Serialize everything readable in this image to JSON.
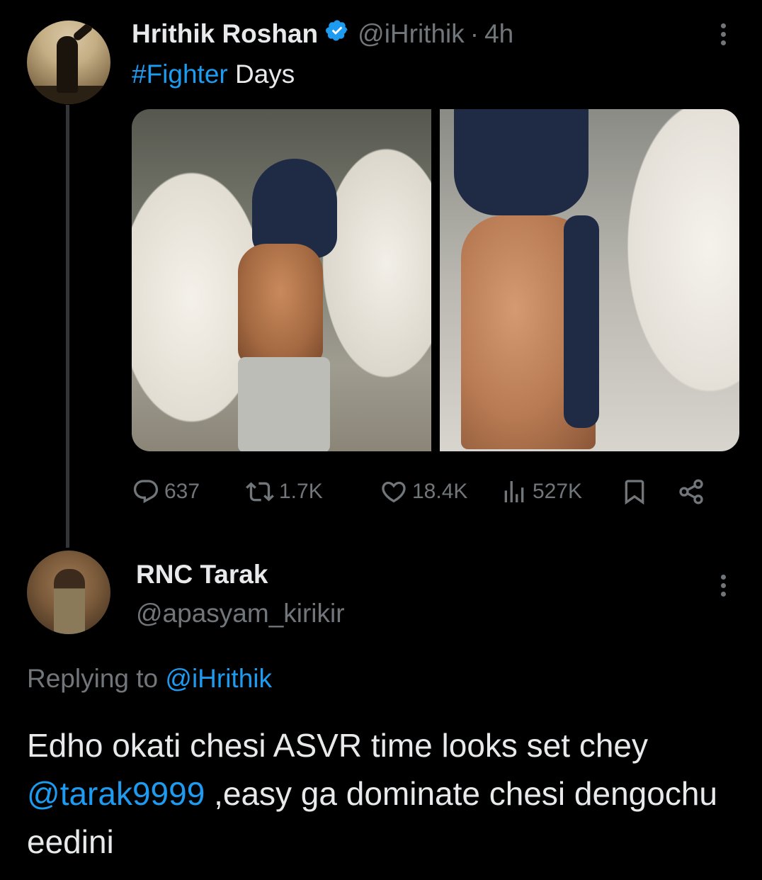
{
  "tweet": {
    "author_name": "Hrithik Roshan",
    "handle": "@iHrithik",
    "dot": "·",
    "time": "4h",
    "hashtag": "#Fighter",
    "text_after_hashtag": " Days",
    "stats": {
      "replies": "637",
      "retweets": "1.7K",
      "likes": "18.4K",
      "views": "527K"
    }
  },
  "reply": {
    "author_name": "RNC Tarak",
    "handle": "@apasyam_kirikir",
    "replying_label": "Replying to ",
    "replying_handle": "@iHrithik",
    "text_part1": "Edho okati chesi ASVR time looks set chey ",
    "mention": "@tarak9999",
    "text_part2": " ,easy ga dominate chesi dengochu eedini"
  },
  "colors": {
    "background": "#000000",
    "text": "#e7e9ea",
    "muted": "#71767b",
    "link": "#1d9bf0"
  }
}
